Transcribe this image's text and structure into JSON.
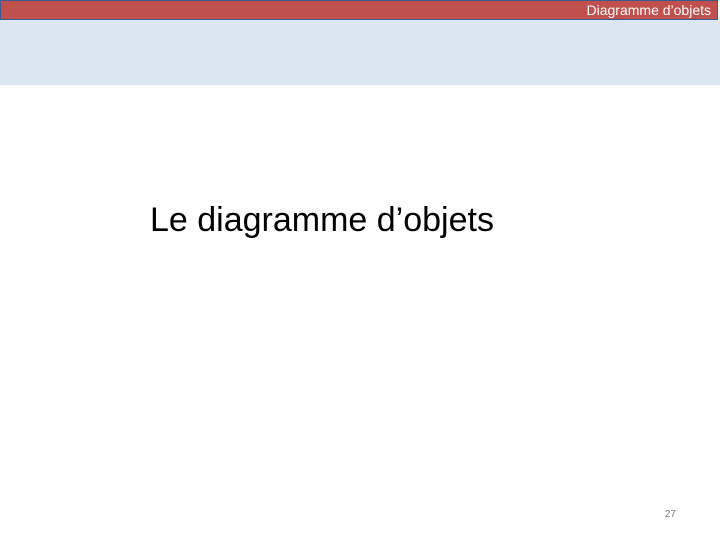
{
  "header": {
    "title": "Diagramme d’objets"
  },
  "slide": {
    "title": "Le diagramme d’objets",
    "page_number": "27"
  },
  "colors": {
    "header_bar": "#c0504d",
    "header_bar_border": "#385d8a",
    "header_band": "#dce6f2",
    "title_text": "#000000",
    "page_number_text": "#7f7f7f"
  }
}
